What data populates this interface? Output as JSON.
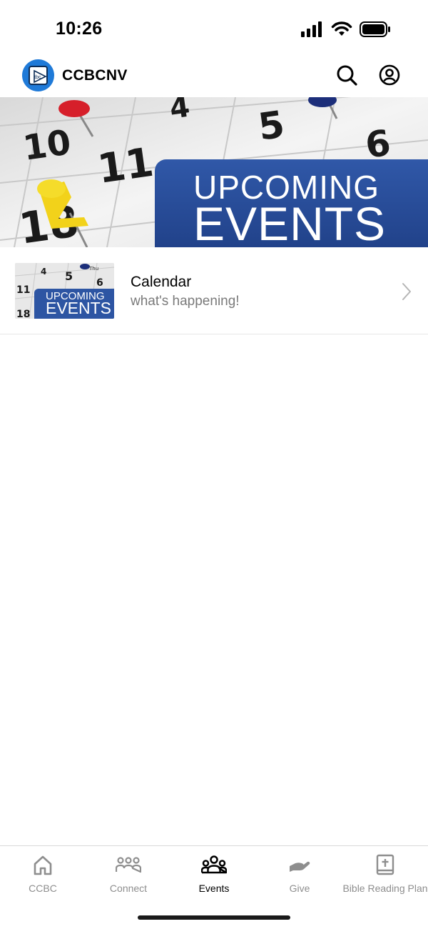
{
  "status_bar": {
    "time": "10:26"
  },
  "header": {
    "title": "CCBCNV"
  },
  "banner": {
    "line1": "UPCOMING",
    "line2": "EVENTS"
  },
  "list": {
    "items": [
      {
        "title": "Calendar",
        "subtitle": "what's happening!",
        "thumb_line1": "UPCOMING",
        "thumb_line2": "EVENTS"
      }
    ]
  },
  "tabs": [
    {
      "label": "CCBC",
      "icon": "home-icon",
      "active": false
    },
    {
      "label": "Connect",
      "icon": "group-icon",
      "active": false
    },
    {
      "label": "Events",
      "icon": "people-icon",
      "active": true
    },
    {
      "label": "Give",
      "icon": "giving-hand-icon",
      "active": false
    },
    {
      "label": "Bible Reading Plan",
      "icon": "bible-icon",
      "active": false
    }
  ],
  "colors": {
    "brand_blue": "#1f7ad8",
    "banner_blue": "#2b51a1",
    "active_tab": "#000000",
    "inactive_tab": "#8e8e8e"
  }
}
